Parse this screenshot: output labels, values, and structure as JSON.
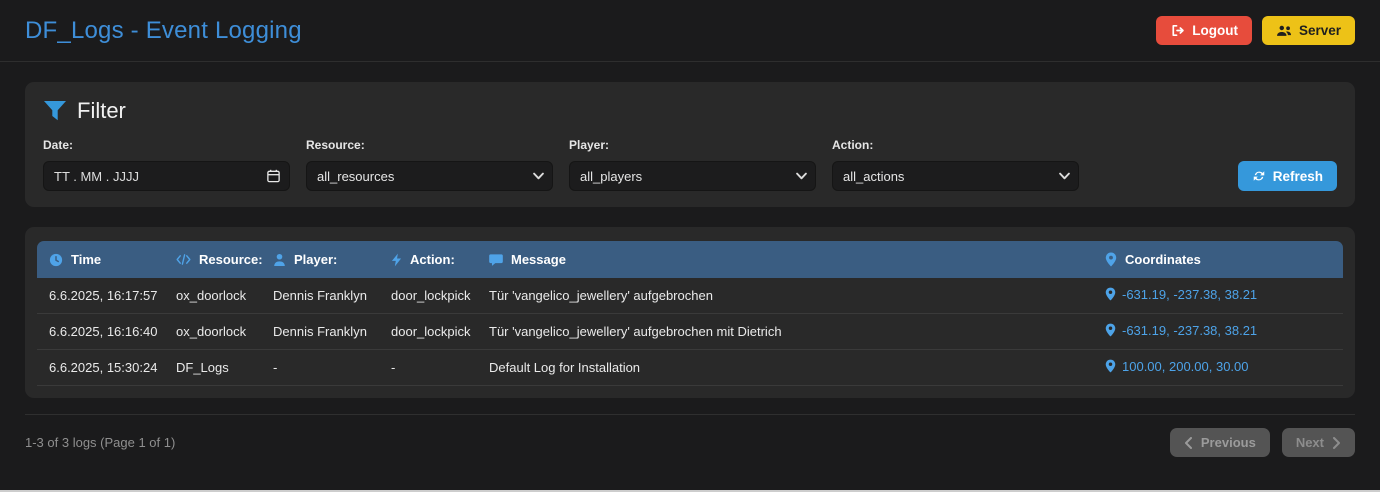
{
  "header": {
    "title": "DF_Logs - Event Logging",
    "logout_label": "Logout",
    "server_label": "Server"
  },
  "filter": {
    "title": "Filter",
    "date_label": "Date:",
    "date_placeholder": "TT . MM . JJJJ",
    "resource_label": "Resource:",
    "resource_value": "all_resources",
    "player_label": "Player:",
    "player_value": "all_players",
    "action_label": "Action:",
    "action_value": "all_actions",
    "refresh_label": "Refresh"
  },
  "table": {
    "columns": [
      {
        "label": "Time",
        "icon": "clock-icon"
      },
      {
        "label": "Resource:",
        "icon": "code-icon"
      },
      {
        "label": "Player:",
        "icon": "user-icon"
      },
      {
        "label": "Action:",
        "icon": "bolt-icon"
      },
      {
        "label": "Message",
        "icon": "chat-icon"
      },
      {
        "label": "Coordinates",
        "icon": "map-pin-icon"
      }
    ],
    "rows": [
      {
        "time": "6.6.2025, 16:17:57",
        "resource": "ox_doorlock",
        "player": "Dennis Franklyn",
        "action": "door_lockpick",
        "message": "Tür 'vangelico_jewellery' aufgebrochen",
        "coordinates": "-631.19, -237.38, 38.21"
      },
      {
        "time": "6.6.2025, 16:16:40",
        "resource": "ox_doorlock",
        "player": "Dennis Franklyn",
        "action": "door_lockpick",
        "message": "Tür 'vangelico_jewellery' aufgebrochen mit Dietrich",
        "coordinates": "-631.19, -237.38, 38.21"
      },
      {
        "time": "6.6.2025, 15:30:24",
        "resource": "DF_Logs",
        "player": "-",
        "action": "-",
        "message": "Default Log for Installation",
        "coordinates": "100.00, 200.00, 30.00"
      }
    ]
  },
  "pagination": {
    "summary": "1-3 of 3 logs (Page 1 of 1)",
    "previous_label": "Previous",
    "next_label": "Next"
  },
  "colors": {
    "title_blue": "#3e8ed8",
    "accent_blue": "#3598db",
    "logout_red": "#e74c3c",
    "server_yellow": "#edc217",
    "table_header_blue": "#3a5d82",
    "link_blue": "#4da3e8"
  }
}
